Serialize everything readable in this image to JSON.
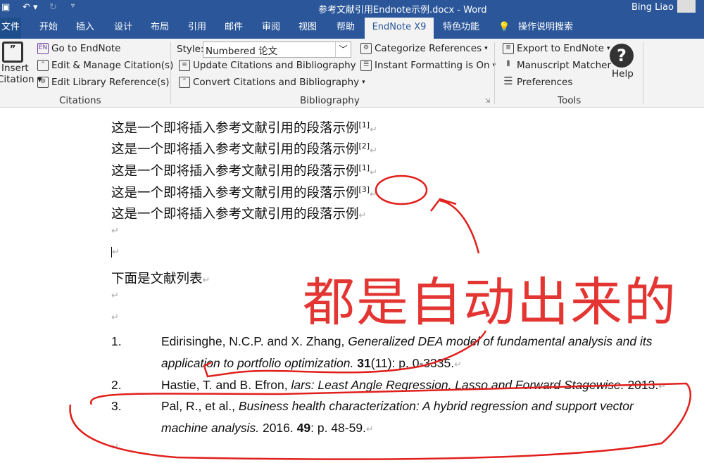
{
  "titlebar": {
    "title": "参考文献引用Endnote示例.docx - Word",
    "user": "Bing Liao"
  },
  "tabs": [
    "文件",
    "开始",
    "插入",
    "设计",
    "布局",
    "引用",
    "邮件",
    "审阅",
    "视图",
    "帮助",
    "EndNote X9",
    "特色功能",
    "操作说明搜索"
  ],
  "ribbon": {
    "citations": {
      "insert": "Insert",
      "insert2": "Citation",
      "go": "Go to EndNote",
      "edit_manage": "Edit & Manage Citation(s)",
      "edit_library": "Edit Library Reference(s)",
      "group": "Citations"
    },
    "bibliography": {
      "style_label": "Style:",
      "style_value": "Numbered 论文",
      "update": "Update Citations and Bibliography",
      "convert": "Convert Citations and Bibliography",
      "categorize": "Categorize References",
      "instant": "Instant Formatting is On",
      "group": "Bibliography"
    },
    "tools": {
      "export": "Export to EndNote",
      "matcher": "Manuscript Matcher",
      "prefs": "Preferences",
      "help": "Help",
      "group": "Tools"
    }
  },
  "document": {
    "paragraphs": [
      {
        "text": "这是一个即将插入参考文献引用的段落示例",
        "cite": "[1]"
      },
      {
        "text": "这是一个即将插入参考文献引用的段落示例",
        "cite": "[2]"
      },
      {
        "text": "这是一个即将插入参考文献引用的段落示例",
        "cite": "[1]"
      },
      {
        "text": "这是一个即将插入参考文献引用的段落示例",
        "cite": "[3]"
      },
      {
        "text": "这是一个即将插入参考文献引用的段落示例",
        "cite": ""
      }
    ],
    "list_heading": "下面是文献列表",
    "references": [
      {
        "num": "1.",
        "authors": "Edirisinghe, N.C.P. and X. Zhang, ",
        "title1": "Generalized DEA model of fundamental analysis and its",
        "title2": "application to portfolio optimization.",
        "vol": "31",
        "rest": "(11): p. 0-3335."
      },
      {
        "num": "2.",
        "authors": "Hastie, T. and B. Efron, ",
        "title1": "lars: Least Angle Regression, Lasso and Forward Stagewise.",
        "rest": " 2013."
      },
      {
        "num": "3.",
        "authors": "Pal, R., et al., ",
        "title1": "Business health characterization: A hybrid regression and support vector",
        "title2": "machine analysis.",
        "year": " 2016. ",
        "vol": "49",
        "rest": ": p. 48-59."
      }
    ],
    "annotation": "都是自动出来的"
  },
  "colors": {
    "word_blue": "#2b579a",
    "annotation_red": "#e0201c"
  }
}
